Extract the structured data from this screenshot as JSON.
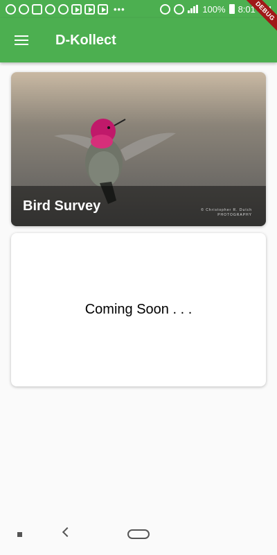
{
  "status_bar": {
    "battery": "100%",
    "time": "8:01 PM",
    "overflow_dots": "•••"
  },
  "app_bar": {
    "title": "D-Kollect",
    "debug_banner": "DEBUG"
  },
  "cards": [
    {
      "caption": "Bird Survey",
      "watermark_line1": "© Christopher R. Dutch",
      "watermark_line2": "PHOTOGRAPHY"
    },
    {
      "message": "Coming Soon . . ."
    }
  ],
  "colors": {
    "primary": "#4caf50",
    "debug": "#a01818",
    "background": "#fafafa"
  }
}
